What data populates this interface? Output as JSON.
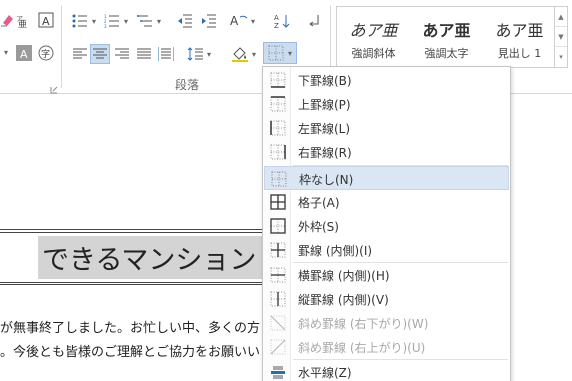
{
  "ribbon": {
    "group_label": "段落",
    "styles": [
      {
        "sample": "あア亜",
        "name": "強調斜体"
      },
      {
        "sample": "あア亜",
        "name": "強調太字"
      },
      {
        "sample": "あア亜",
        "name": "見出し 1"
      }
    ],
    "styles_scroll": [
      "▲",
      "▼",
      "▾"
    ],
    "dropdown_arrow": "▾"
  },
  "document": {
    "title": "できるマンション",
    "line1": "が無事終了しました。お忙しい中、多くの方",
    "line2": "。今後とも皆様のご理解とご協力をお願いい"
  },
  "border_menu": {
    "items": [
      {
        "label": "下罫線(B)",
        "icon": "bottom-border-icon",
        "disabled": false,
        "hover": false
      },
      {
        "label": "上罫線(P)",
        "icon": "top-border-icon",
        "disabled": false,
        "hover": false
      },
      {
        "label": "左罫線(L)",
        "icon": "left-border-icon",
        "disabled": false,
        "hover": false
      },
      {
        "label": "右罫線(R)",
        "icon": "right-border-icon",
        "disabled": false,
        "hover": false
      },
      {
        "label": "枠なし(N)",
        "icon": "no-border-icon",
        "disabled": false,
        "hover": true
      },
      {
        "label": "格子(A)",
        "icon": "all-borders-icon",
        "disabled": false,
        "hover": false
      },
      {
        "label": "外枠(S)",
        "icon": "outside-borders-icon",
        "disabled": false,
        "hover": false
      },
      {
        "label": "罫線 (内側)(I)",
        "icon": "inside-borders-icon",
        "disabled": false,
        "hover": false
      },
      {
        "label": "横罫線 (内側)(H)",
        "icon": "inside-horizontal-border-icon",
        "disabled": false,
        "hover": false
      },
      {
        "label": "縦罫線 (内側)(V)",
        "icon": "inside-vertical-border-icon",
        "disabled": false,
        "hover": false
      },
      {
        "label": "斜め罫線 (右下がり)(W)",
        "icon": "diagonal-down-border-icon",
        "disabled": true,
        "hover": false
      },
      {
        "label": "斜め罫線 (右上がり)(U)",
        "icon": "diagonal-up-border-icon",
        "disabled": true,
        "hover": false
      },
      {
        "label": "水平線(Z)",
        "icon": "horizontal-line-icon",
        "disabled": false,
        "hover": false
      }
    ]
  },
  "colors": {
    "hover_bg": "#dbe6f4",
    "selection_gray": "#d4d4d4",
    "active_button": "#c9dcf0",
    "text_dark": "#222222"
  }
}
